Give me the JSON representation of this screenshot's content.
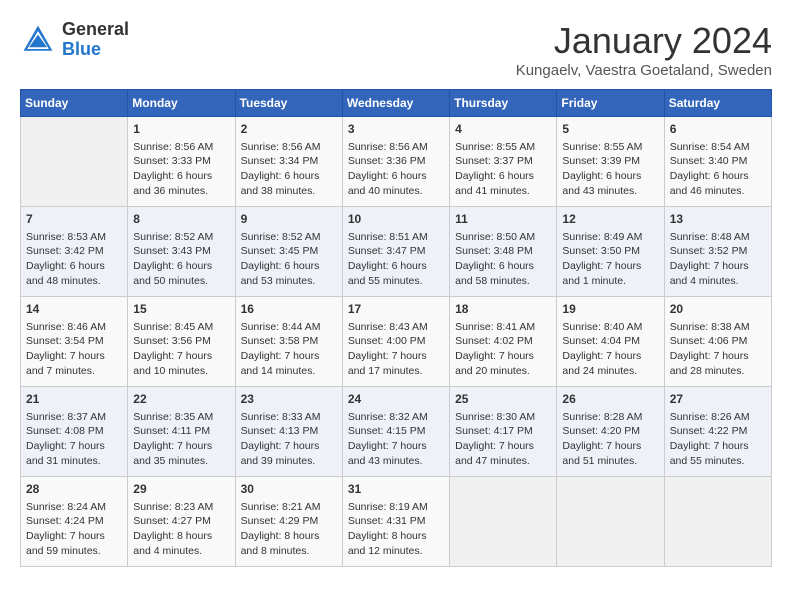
{
  "header": {
    "logo": {
      "general": "General",
      "blue": "Blue"
    },
    "title": "January 2024",
    "location": "Kungaelv, Vaestra Goetaland, Sweden"
  },
  "weekdays": [
    "Sunday",
    "Monday",
    "Tuesday",
    "Wednesday",
    "Thursday",
    "Friday",
    "Saturday"
  ],
  "weeks": [
    [
      {
        "day": "",
        "info": ""
      },
      {
        "day": "1",
        "info": "Sunrise: 8:56 AM\nSunset: 3:33 PM\nDaylight: 6 hours\nand 36 minutes."
      },
      {
        "day": "2",
        "info": "Sunrise: 8:56 AM\nSunset: 3:34 PM\nDaylight: 6 hours\nand 38 minutes."
      },
      {
        "day": "3",
        "info": "Sunrise: 8:56 AM\nSunset: 3:36 PM\nDaylight: 6 hours\nand 40 minutes."
      },
      {
        "day": "4",
        "info": "Sunrise: 8:55 AM\nSunset: 3:37 PM\nDaylight: 6 hours\nand 41 minutes."
      },
      {
        "day": "5",
        "info": "Sunrise: 8:55 AM\nSunset: 3:39 PM\nDaylight: 6 hours\nand 43 minutes."
      },
      {
        "day": "6",
        "info": "Sunrise: 8:54 AM\nSunset: 3:40 PM\nDaylight: 6 hours\nand 46 minutes."
      }
    ],
    [
      {
        "day": "7",
        "info": "Sunrise: 8:53 AM\nSunset: 3:42 PM\nDaylight: 6 hours\nand 48 minutes."
      },
      {
        "day": "8",
        "info": "Sunrise: 8:52 AM\nSunset: 3:43 PM\nDaylight: 6 hours\nand 50 minutes."
      },
      {
        "day": "9",
        "info": "Sunrise: 8:52 AM\nSunset: 3:45 PM\nDaylight: 6 hours\nand 53 minutes."
      },
      {
        "day": "10",
        "info": "Sunrise: 8:51 AM\nSunset: 3:47 PM\nDaylight: 6 hours\nand 55 minutes."
      },
      {
        "day": "11",
        "info": "Sunrise: 8:50 AM\nSunset: 3:48 PM\nDaylight: 6 hours\nand 58 minutes."
      },
      {
        "day": "12",
        "info": "Sunrise: 8:49 AM\nSunset: 3:50 PM\nDaylight: 7 hours\nand 1 minute."
      },
      {
        "day": "13",
        "info": "Sunrise: 8:48 AM\nSunset: 3:52 PM\nDaylight: 7 hours\nand 4 minutes."
      }
    ],
    [
      {
        "day": "14",
        "info": "Sunrise: 8:46 AM\nSunset: 3:54 PM\nDaylight: 7 hours\nand 7 minutes."
      },
      {
        "day": "15",
        "info": "Sunrise: 8:45 AM\nSunset: 3:56 PM\nDaylight: 7 hours\nand 10 minutes."
      },
      {
        "day": "16",
        "info": "Sunrise: 8:44 AM\nSunset: 3:58 PM\nDaylight: 7 hours\nand 14 minutes."
      },
      {
        "day": "17",
        "info": "Sunrise: 8:43 AM\nSunset: 4:00 PM\nDaylight: 7 hours\nand 17 minutes."
      },
      {
        "day": "18",
        "info": "Sunrise: 8:41 AM\nSunset: 4:02 PM\nDaylight: 7 hours\nand 20 minutes."
      },
      {
        "day": "19",
        "info": "Sunrise: 8:40 AM\nSunset: 4:04 PM\nDaylight: 7 hours\nand 24 minutes."
      },
      {
        "day": "20",
        "info": "Sunrise: 8:38 AM\nSunset: 4:06 PM\nDaylight: 7 hours\nand 28 minutes."
      }
    ],
    [
      {
        "day": "21",
        "info": "Sunrise: 8:37 AM\nSunset: 4:08 PM\nDaylight: 7 hours\nand 31 minutes."
      },
      {
        "day": "22",
        "info": "Sunrise: 8:35 AM\nSunset: 4:11 PM\nDaylight: 7 hours\nand 35 minutes."
      },
      {
        "day": "23",
        "info": "Sunrise: 8:33 AM\nSunset: 4:13 PM\nDaylight: 7 hours\nand 39 minutes."
      },
      {
        "day": "24",
        "info": "Sunrise: 8:32 AM\nSunset: 4:15 PM\nDaylight: 7 hours\nand 43 minutes."
      },
      {
        "day": "25",
        "info": "Sunrise: 8:30 AM\nSunset: 4:17 PM\nDaylight: 7 hours\nand 47 minutes."
      },
      {
        "day": "26",
        "info": "Sunrise: 8:28 AM\nSunset: 4:20 PM\nDaylight: 7 hours\nand 51 minutes."
      },
      {
        "day": "27",
        "info": "Sunrise: 8:26 AM\nSunset: 4:22 PM\nDaylight: 7 hours\nand 55 minutes."
      }
    ],
    [
      {
        "day": "28",
        "info": "Sunrise: 8:24 AM\nSunset: 4:24 PM\nDaylight: 7 hours\nand 59 minutes."
      },
      {
        "day": "29",
        "info": "Sunrise: 8:23 AM\nSunset: 4:27 PM\nDaylight: 8 hours\nand 4 minutes."
      },
      {
        "day": "30",
        "info": "Sunrise: 8:21 AM\nSunset: 4:29 PM\nDaylight: 8 hours\nand 8 minutes."
      },
      {
        "day": "31",
        "info": "Sunrise: 8:19 AM\nSunset: 4:31 PM\nDaylight: 8 hours\nand 12 minutes."
      },
      {
        "day": "",
        "info": ""
      },
      {
        "day": "",
        "info": ""
      },
      {
        "day": "",
        "info": ""
      }
    ]
  ]
}
